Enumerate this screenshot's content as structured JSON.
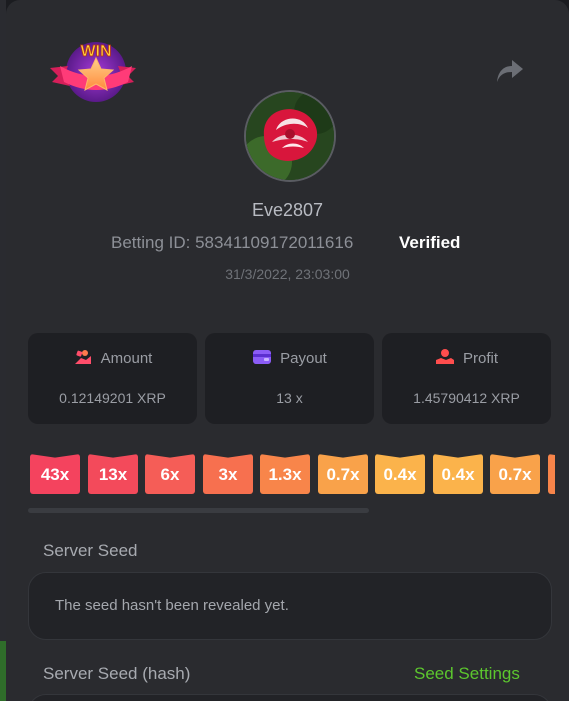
{
  "user": {
    "name": "Eve2807",
    "betting_id": "Betting ID: 58341109172011616",
    "status": "Verified",
    "timestamp": "31/3/2022, 23:03:00"
  },
  "badge": {
    "text": "WIN"
  },
  "stats": [
    {
      "label": "Amount",
      "value": "0.12149201 XRP",
      "icon": "money-hand-icon",
      "color": "#ff4d6a"
    },
    {
      "label": "Payout",
      "value": "13 x",
      "icon": "wallet-icon",
      "color": "#8b5cf6"
    },
    {
      "label": "Profit",
      "value": "1.45790412 XRP",
      "icon": "coin-hand-icon",
      "color": "#ff4d4d"
    }
  ],
  "multipliers": [
    {
      "label": "43x",
      "color": "#f4435e"
    },
    {
      "label": "13x",
      "color": "#f34a5b"
    },
    {
      "label": "6x",
      "color": "#f55d57"
    },
    {
      "label": "3x",
      "color": "#f7704f"
    },
    {
      "label": "1.3x",
      "color": "#f8854a"
    },
    {
      "label": "0.7x",
      "color": "#f9a24a"
    },
    {
      "label": "0.4x",
      "color": "#fbb34b"
    },
    {
      "label": "0.4x",
      "color": "#fbb34b"
    },
    {
      "label": "0.7x",
      "color": "#f9a24a"
    },
    {
      "label": "",
      "color": "#f8854a"
    }
  ],
  "server_seed": {
    "label": "Server Seed",
    "value": "The seed hasn't been revealed yet."
  },
  "server_seed_hash": {
    "label": "Server Seed (hash)",
    "settings_link": "Seed Settings"
  }
}
